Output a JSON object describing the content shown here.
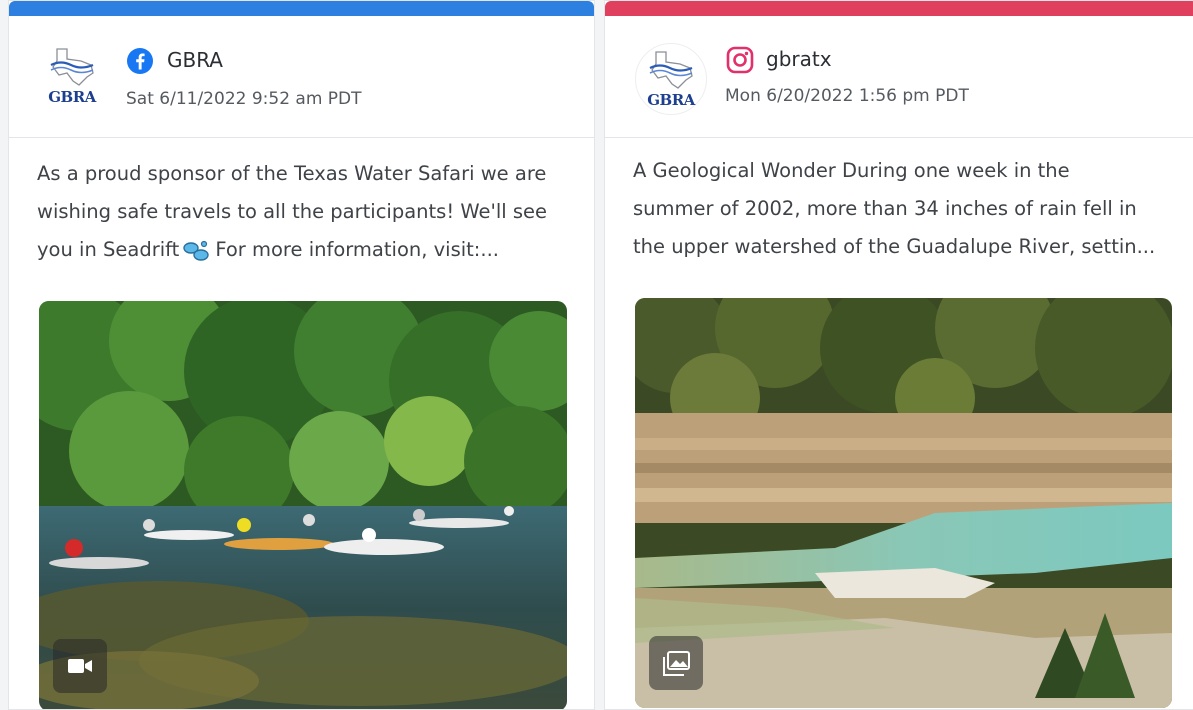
{
  "posts": [
    {
      "network": "facebook",
      "network_icon": "facebook-icon",
      "accent_color": "#2d7fe0",
      "logo_text": "GBRA",
      "account": "GBRA",
      "date": "Sat 6/11/2022 9:52 am PDT",
      "text_lines": [
        "As a proud sponsor of the Texas Water Safari we are",
        "wishing safe travels to all the participants! We'll see",
        "you in Seadrift",
        "For more information, visit:..."
      ],
      "emoji": "canoe-splash-emoji",
      "media_type": "video",
      "media_icon": "video-camera-icon"
    },
    {
      "network": "instagram",
      "network_icon": "instagram-icon",
      "accent_color": "#e0405e",
      "logo_text": "GBRA",
      "account": "gbratx",
      "date": "Mon 6/20/2022 1:56 pm PDT",
      "text_lines": [
        "A Geological Wonder During one week in the",
        "summer of 2002, more than 34 inches of rain fell in",
        "the upper watershed of the Guadalupe River, settin..."
      ],
      "media_type": "image",
      "media_icon": "image-gallery-icon"
    }
  ]
}
